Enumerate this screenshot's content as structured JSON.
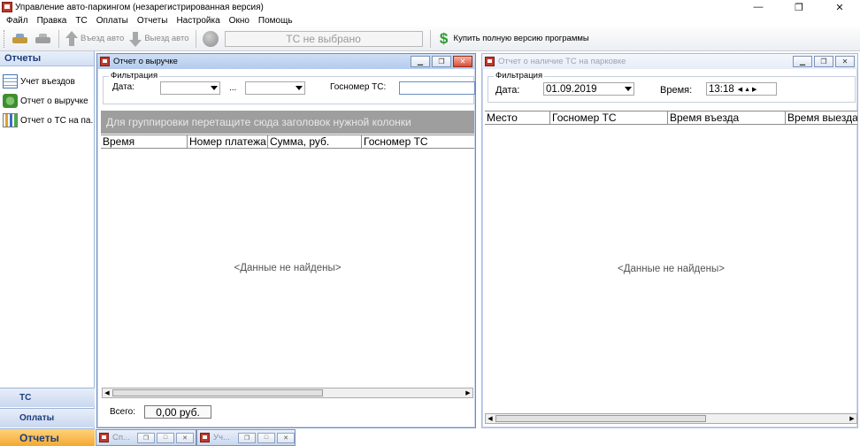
{
  "window": {
    "title": "Управление авто-паркингом (незарегистрированная версия)",
    "controls": [
      "—",
      "❐",
      "✕"
    ]
  },
  "menu": [
    "Файл",
    "Правка",
    "ТС",
    "Оплаты",
    "Отчеты",
    "Настройка",
    "Окно",
    "Помощь"
  ],
  "toolbar": {
    "entry_label": "Въезд авто",
    "exit_label": "Выезд авто",
    "tc_field": "ТС не выбрано",
    "buy_label": "Купить полную версию программы"
  },
  "nav": {
    "header": "Отчеты",
    "items": [
      {
        "label": "Учет въездов",
        "icon": "table-icon"
      },
      {
        "label": "Отчет о выручке",
        "icon": "money-icon"
      },
      {
        "label": "Отчет о ТС на па...",
        "icon": "chart-icon"
      }
    ],
    "bottom": [
      {
        "label": "ТС"
      },
      {
        "label": "Оплаты"
      },
      {
        "label": "Отчеты"
      }
    ]
  },
  "revenue_window": {
    "title": "Отчет о выручке",
    "filter_title": "Фильтрация",
    "date_label": "Дата:",
    "date_from": "",
    "range_sep": "...",
    "date_to": "",
    "plate_label": "Госномер ТС:",
    "plate_value": "",
    "group_hint": "Для группировки перетащите сюда заголовок нужной колонки",
    "columns": [
      "Время",
      "Номер платежа",
      "Сумма, руб.",
      "Госномер ТС"
    ],
    "empty": "<Данные не найдены>",
    "total_label": "Всего:",
    "total_value": "0,00 руб."
  },
  "parking_window": {
    "title": "Отчет о наличие ТС на парковке",
    "filter_title": "Фильтрация",
    "date_label": "Дата:",
    "date_value": "01.09.2019",
    "time_label": "Время:",
    "time_value": "13:18",
    "columns": [
      "Место",
      "Госномер ТС",
      "Время въезда",
      "Время выезда"
    ],
    "empty": "<Данные не найдены>"
  },
  "minimized": [
    {
      "label": "Сп..."
    },
    {
      "label": "Уч..."
    }
  ]
}
